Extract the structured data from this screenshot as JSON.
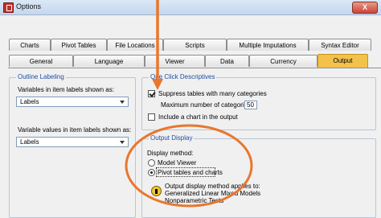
{
  "window": {
    "title": "Options",
    "close_label": "X"
  },
  "tabs_row1": [
    "Charts",
    "Pivot Tables",
    "File Locations",
    "Scripts",
    "Multiple Imputations",
    "Syntax Editor"
  ],
  "tabs_row2": [
    "General",
    "Language",
    "Viewer",
    "Data",
    "Currency",
    "Output"
  ],
  "active_tab": "Output",
  "outline_labeling": {
    "title": "Outline Labeling",
    "variables_label": "Variables in item labels shown as:",
    "variables_value": "Labels",
    "values_label": "Variable values in item labels shown as:",
    "values_value": "Labels"
  },
  "descriptives": {
    "title": "One Click Descriptives",
    "suppress_label": "Suppress tables with many categories",
    "suppress_checked": true,
    "max_label": "Maximum number of categories:",
    "max_value": "50",
    "chart_label": "Include a chart in the output",
    "chart_checked": false
  },
  "output_display": {
    "title": "Output Display",
    "method_label": "Display method:",
    "option_model_viewer": "Model Viewer",
    "option_pivot": "Pivot tables and charts",
    "selected": "Pivot tables and charts",
    "note_line1": "Output display method applies to:",
    "note_line2": "Generalized Linear Mixed Models",
    "note_line3": "Nonparametric Tests"
  },
  "annotation_color": "#e8772e"
}
